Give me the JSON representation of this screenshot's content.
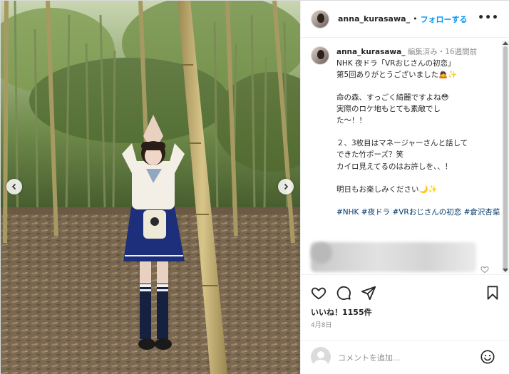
{
  "post": {
    "username": "anna_kurasawa_",
    "follow_label": "フォローする",
    "dot": "•",
    "more_label": "•••"
  },
  "caption": {
    "username": "anna_kurasawa_",
    "meta": "編集済み・16週間前",
    "lines": [
      "NHK 夜ドラ「VRおじさんの初恋」",
      "第5回ありがとうございました🙇✨",
      "",
      "命の森、すっごく綺麗ですよね😳",
      "実際のロケ地もとても素敵でし",
      "た〜！！",
      "",
      "２、3枚目はマネージャーさんと話して",
      "できた竹ポーズ？笑",
      "カイロ見えてるのはお許しを、、！",
      "",
      "明日もお楽しみください🌙✨",
      ""
    ],
    "hashtags": [
      "#NHK",
      "#夜ドラ",
      "#VRおじさんの初恋",
      "#倉沢杏菜"
    ]
  },
  "actions": {
    "likes": "いいね！1155件",
    "date": "4月8日"
  },
  "comment_input": {
    "placeholder": "コメントを追加..."
  },
  "icons": {
    "prev": "chevron-left-icon",
    "next": "chevron-right-icon",
    "like": "heart-icon",
    "comment": "comment-bubble-icon",
    "share": "paper-plane-icon",
    "save": "bookmark-icon",
    "emoji": "emoji-icon"
  },
  "colors": {
    "follow_blue": "#0095f6",
    "hashtag_blue": "#00376b",
    "muted_gray": "#8e8e8e"
  }
}
